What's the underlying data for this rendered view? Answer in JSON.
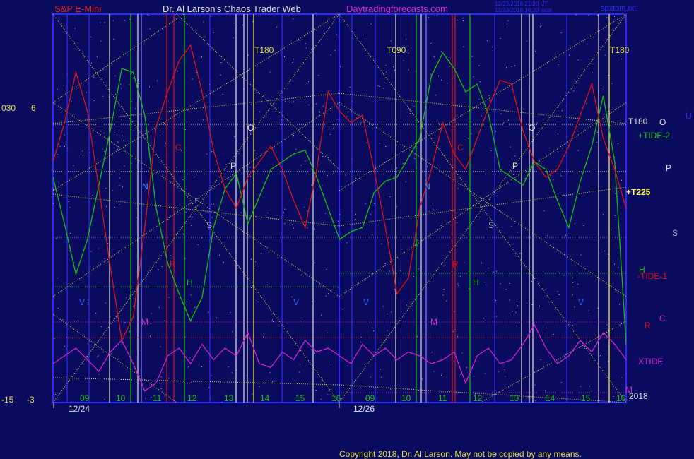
{
  "header": {
    "instrument": "S&P E-Mini",
    "site": "Dr. Al Larson's Chaos Trader Web",
    "url": "Daytradingforecasts.com",
    "timestamp1": "12/23/2018 21:20 UT",
    "timestamp2": "12/23/2018 16:20 local",
    "file": "spxtom.txt"
  },
  "footer": {
    "copyright": "Copyright 2018, Dr. Al Larson. May not be copied by any means."
  },
  "left_scale": {
    "top_a": "030",
    "top_b": "6",
    "bot_a": "-15",
    "bot_b": "-3"
  },
  "right_labels": {
    "t180": "T180",
    "o": "O",
    "u": "U",
    "tide2": "+TIDE-2",
    "p": "P",
    "t225": "+T225",
    "s": "S",
    "h": "H",
    "tide1": "-TIDE-1",
    "c": "C",
    "r": "R",
    "xtide": "XTIDE",
    "m": "M",
    "year": "2018"
  },
  "markers": {
    "t180a": "T180",
    "t090": "T090",
    "t180b": "T180",
    "o": "O",
    "n": "N",
    "c": "C",
    "p": "P",
    "s": "S",
    "r": "R",
    "h": "H",
    "v": "V",
    "m": "M",
    "j": "J"
  },
  "x_axis": {
    "hours": [
      "09",
      "10",
      "11",
      "12",
      "13",
      "14",
      "15",
      "16",
      "09",
      "10",
      "11",
      "12",
      "13",
      "14",
      "15",
      "16"
    ],
    "dates": [
      "12/24",
      "12/26"
    ]
  },
  "colors": {
    "background": "#0a0a5e",
    "plot_border": "#2a2aff",
    "red": "#e01010",
    "green": "#10c010",
    "magenta": "#d020d0",
    "yellow": "#e0e040",
    "white": "#e0e0e0",
    "blue": "#3030ff",
    "label_red": "#e02020"
  },
  "chart_data": {
    "type": "line",
    "title": "S&P E-Mini",
    "series": [
      {
        "name": "+TIDE-2",
        "color": "#10c010",
        "x": [
          0,
          2,
          4,
          6,
          8,
          10,
          12,
          14,
          16,
          18,
          20,
          22,
          24,
          26,
          28,
          30,
          32,
          34,
          36,
          38,
          40,
          42,
          44,
          46,
          48,
          50,
          52,
          54,
          56,
          58,
          60,
          62,
          64,
          66,
          68,
          70,
          72,
          74,
          76,
          78,
          80,
          82,
          84,
          86,
          88,
          90,
          92,
          94,
          96,
          98,
          100
        ],
        "y": [
          0.58,
          0.46,
          0.33,
          0.42,
          0.56,
          0.7,
          0.86,
          0.85,
          0.74,
          0.5,
          0.36,
          0.28,
          0.21,
          0.27,
          0.45,
          0.55,
          0.59,
          0.46,
          0.53,
          0.6,
          0.62,
          0.64,
          0.65,
          0.58,
          0.5,
          0.42,
          0.44,
          0.45,
          0.54,
          0.57,
          0.58,
          0.63,
          0.68,
          0.84,
          0.9,
          0.86,
          0.8,
          0.82,
          0.74,
          0.6,
          0.58,
          0.56,
          0.62,
          0.6,
          0.52,
          0.45,
          0.57,
          0.66,
          0.79,
          0.62,
          0.15
        ]
      },
      {
        "name": "-TIDE-1",
        "color": "#e01010",
        "x": [
          0,
          2,
          4,
          6,
          8,
          10,
          12,
          14,
          16,
          18,
          20,
          22,
          24,
          26,
          28,
          30,
          32,
          34,
          36,
          38,
          40,
          42,
          44,
          46,
          48,
          50,
          52,
          54,
          56,
          58,
          60,
          62,
          64,
          66,
          68,
          70,
          72,
          74,
          76,
          78,
          80,
          82,
          84,
          86,
          88,
          90,
          92,
          94,
          96,
          98,
          100
        ],
        "y": [
          0.62,
          0.72,
          0.85,
          0.75,
          0.55,
          0.35,
          0.16,
          0.22,
          0.45,
          0.71,
          0.8,
          0.88,
          0.92,
          0.8,
          0.65,
          0.55,
          0.5,
          0.58,
          0.62,
          0.66,
          0.6,
          0.52,
          0.45,
          0.6,
          0.8,
          0.75,
          0.72,
          0.74,
          0.6,
          0.45,
          0.28,
          0.32,
          0.5,
          0.6,
          0.72,
          0.64,
          0.6,
          0.68,
          0.76,
          0.83,
          0.82,
          0.7,
          0.62,
          0.58,
          0.6,
          0.66,
          0.74,
          0.82,
          0.68,
          0.6,
          0.5
        ]
      },
      {
        "name": "XTIDE",
        "color": "#d020d0",
        "x": [
          0,
          2,
          4,
          6,
          8,
          10,
          12,
          14,
          16,
          18,
          20,
          22,
          24,
          26,
          28,
          30,
          32,
          34,
          36,
          38,
          40,
          42,
          44,
          46,
          48,
          50,
          52,
          54,
          56,
          58,
          60,
          62,
          64,
          66,
          68,
          70,
          72,
          74,
          76,
          78,
          80,
          82,
          84,
          86,
          88,
          90,
          92,
          94,
          96,
          98,
          100
        ],
        "y": [
          0.1,
          0.12,
          0.14,
          0.11,
          0.08,
          0.13,
          0.16,
          0.1,
          0.03,
          0.05,
          0.12,
          0.14,
          0.1,
          0.15,
          0.11,
          0.14,
          0.12,
          0.18,
          0.1,
          0.09,
          0.13,
          0.11,
          0.16,
          0.13,
          0.14,
          0.12,
          0.1,
          0.15,
          0.12,
          0.14,
          0.11,
          0.13,
          0.12,
          0.1,
          0.11,
          0.13,
          0.05,
          0.12,
          0.14,
          0.1,
          0.11,
          0.15,
          0.2,
          0.14,
          0.1,
          0.12,
          0.16,
          0.13,
          0.18,
          0.15,
          0.11
        ]
      }
    ],
    "x_ticks": [
      "09",
      "10",
      "11",
      "12",
      "13",
      "14",
      "15",
      "16",
      "09",
      "10",
      "11",
      "12",
      "13",
      "14",
      "15",
      "16"
    ],
    "x_dates": [
      "12/24",
      "12/26"
    ],
    "grid": true
  }
}
